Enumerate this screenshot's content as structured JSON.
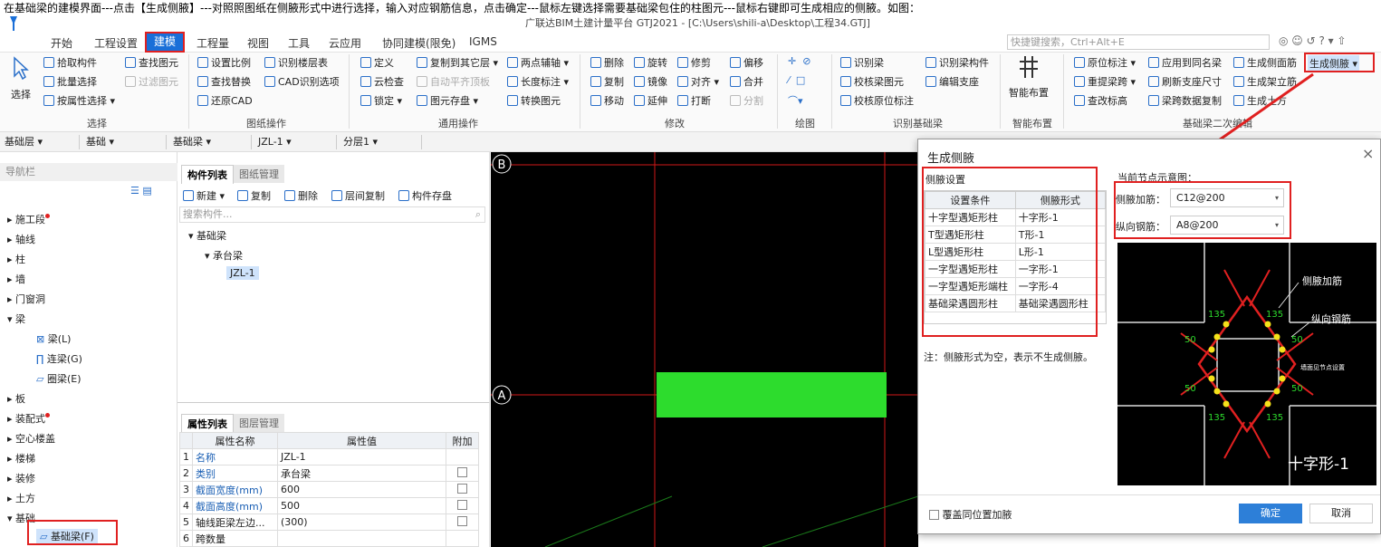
{
  "caption": "在基础梁的建模界面---点击【生成侧腋】---对照照图纸在侧腋形式中进行选择，输入对应钢筋信息，点击确定---鼠标左键选择需要基础梁包住的柱图元---鼠标右键即可生成相应的侧腋。如图：",
  "title_path": "广联达BIM土建计量平台 GTJ2021 - [C:\\Users\\shili-a\\Desktop\\工程34.GTJ]",
  "menu": {
    "items": [
      "开始",
      "工程设置",
      "建模",
      "工程量",
      "视图",
      "工具",
      "云应用",
      "协同建模(限免)",
      "IGMS"
    ],
    "search_placeholder": "快捷键搜索，Ctrl+Alt+E"
  },
  "ribbon": {
    "select": {
      "big": "选择",
      "items": [
        "拾取构件",
        "批量选择",
        "按属性选择",
        "查找图元",
        "过滤图元"
      ],
      "group": "选择"
    },
    "drawing": {
      "items": [
        "设置比例",
        "识别楼层表",
        "查找替换",
        "CAD识别选项",
        "还原CAD"
      ],
      "group": "图纸操作"
    },
    "common": {
      "items": [
        "定义",
        "复制到其它层",
        "两点辅轴",
        "云检查",
        "自动平齐顶板",
        "长度标注",
        "锁定",
        "图元存盘",
        "转换图元"
      ],
      "group": "通用操作"
    },
    "modify": {
      "items": [
        "删除",
        "旋转",
        "修剪",
        "偏移",
        "复制",
        "镜像",
        "对齐",
        "合并",
        "移动",
        "延伸",
        "打断",
        "分割"
      ],
      "group": "修改"
    },
    "draw": {
      "group": "绘图"
    },
    "recognize": {
      "items": [
        "识别梁",
        "识别梁构件",
        "校核梁图元",
        "编辑支座",
        "校核原位标注"
      ],
      "group": "识别基础梁"
    },
    "smart": {
      "big": "智能布置",
      "group": "智能布置"
    },
    "secondary": {
      "items": [
        "原位标注",
        "应用到同名梁",
        "生成侧面筋",
        "生成侧腋",
        "重提梁跨",
        "刷新支座尺寸",
        "生成架立筋",
        "查改标高",
        "梁跨数据复制",
        "生成土方"
      ],
      "group": "基础梁二次编辑"
    }
  },
  "selectors": [
    "基础层",
    "基础",
    "基础梁",
    "JZL-1",
    "分层1"
  ],
  "nav": {
    "title": "导航栏",
    "items": [
      "施工段",
      "轴线",
      "柱",
      "墙",
      "门窗洞",
      "梁",
      "梁(L)",
      "连梁(G)",
      "圈梁(E)",
      "板",
      "装配式",
      "空心楼盖",
      "楼梯",
      "装修",
      "土方",
      "基础",
      "基础梁(F)"
    ]
  },
  "component": {
    "tabs": [
      "构件列表",
      "图纸管理"
    ],
    "tools": [
      "新建",
      "复制",
      "删除",
      "层间复制",
      "构件存盘"
    ],
    "search": "搜索构件...",
    "tree": [
      "基础梁",
      "承台梁",
      "JZL-1"
    ]
  },
  "properties": {
    "tabs": [
      "属性列表",
      "图层管理"
    ],
    "headers": [
      "属性名称",
      "属性值",
      "附加"
    ],
    "rows": [
      {
        "num": "1",
        "name": "名称",
        "value": "JZL-1"
      },
      {
        "num": "2",
        "name": "类别",
        "value": "承台梁"
      },
      {
        "num": "3",
        "name": "截面宽度(mm)",
        "value": "600"
      },
      {
        "num": "4",
        "name": "截面高度(mm)",
        "value": "500"
      },
      {
        "num": "5",
        "name": "轴线距梁左边...",
        "value": "(300)"
      },
      {
        "num": "6",
        "name": "跨数量",
        "value": ""
      }
    ]
  },
  "canvas": {
    "axis_b": "B",
    "axis_a": "A"
  },
  "dialog": {
    "title": "生成侧腋",
    "settings_label": "侧腋设置",
    "col_headers": [
      "设置条件",
      "侧腋形式"
    ],
    "rows": [
      {
        "cond": "十字型遇矩形柱",
        "form": "十字形-1"
      },
      {
        "cond": "T型遇矩形柱",
        "form": "T形-1"
      },
      {
        "cond": "L型遇矩形柱",
        "form": "L形-1"
      },
      {
        "cond": "一字型遇矩形柱",
        "form": "一字形-1"
      },
      {
        "cond": "一字型遇矩形端柱",
        "form": "一字形-4"
      },
      {
        "cond": "基础梁遇圆形柱",
        "form": "基础梁遇圆形柱"
      }
    ],
    "note": "注：侧腋形式为空，表示不生成侧腋。",
    "preview_label": "当前节点示意图：",
    "haunch_rebar_label": "侧腋加筋：",
    "haunch_rebar_value": "C12@200",
    "long_rebar_label": "纵向钢筋：",
    "long_rebar_value": "A8@200",
    "diagram": {
      "label1": "侧腋加筋",
      "label2": "纵向钢筋",
      "label3": "墙面见节点设置",
      "angle": "135",
      "len": "50",
      "shape": "十字形-1"
    },
    "overlay_label": "覆盖同位置加腋",
    "ok": "确定",
    "cancel": "取消"
  },
  "colors": {
    "accent": "#1a6fd8",
    "highlight": "#e02020",
    "beam": "#2ddc2d"
  }
}
